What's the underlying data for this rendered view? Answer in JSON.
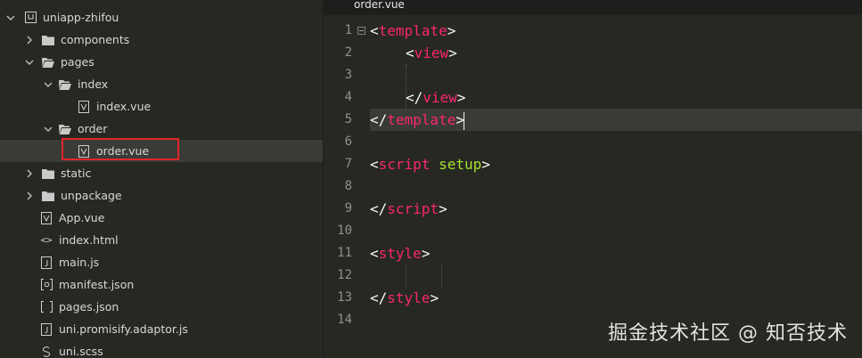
{
  "sidebar": {
    "root": "uniapp-zhifou",
    "items": [
      {
        "label": "components"
      },
      {
        "label": "pages"
      },
      {
        "label": "index"
      },
      {
        "label": "index.vue"
      },
      {
        "label": "order"
      },
      {
        "label": "order.vue"
      },
      {
        "label": "static"
      },
      {
        "label": "unpackage"
      },
      {
        "label": "App.vue"
      },
      {
        "label": "index.html"
      },
      {
        "label": "main.js"
      },
      {
        "label": "manifest.json"
      },
      {
        "label": "pages.json"
      },
      {
        "label": "uni.promisify.adaptor.js"
      },
      {
        "label": "uni.scss"
      }
    ]
  },
  "editor": {
    "tab": "order.vue",
    "line_numbers": [
      "1",
      "2",
      "3",
      "4",
      "5",
      "6",
      "7",
      "8",
      "9",
      "10",
      "11",
      "12",
      "13",
      "14"
    ],
    "code": {
      "l1_tag": "template",
      "l2_tag": "view",
      "l4_tag": "view",
      "l5_tag": "template",
      "l7_tag": "script",
      "l7_attr": "setup",
      "l9_tag": "script",
      "l11_tag": "style",
      "l13_tag": "style"
    },
    "current_line": 5
  },
  "watermark": "掘金技术社区 @ 知否技术"
}
